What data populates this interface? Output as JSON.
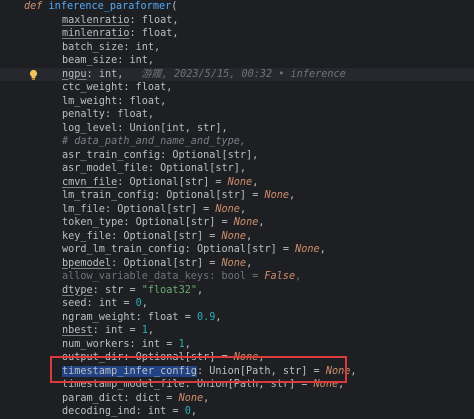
{
  "editor": {
    "lines": [
      {
        "kind": "def",
        "tokens": [
          [
            "kw",
            "def"
          ],
          [
            "sp",
            " "
          ],
          [
            "fn",
            "inference_paraformer"
          ],
          [
            "p",
            "("
          ]
        ]
      },
      {
        "tokens": [
          [
            "pu",
            "maxlenratio"
          ],
          [
            "p",
            ": "
          ],
          [
            "type",
            "float"
          ],
          [
            "p",
            ","
          ]
        ]
      },
      {
        "tokens": [
          [
            "pu",
            "minlenratio"
          ],
          [
            "p",
            ": "
          ],
          [
            "type",
            "float"
          ],
          [
            "p",
            ","
          ]
        ]
      },
      {
        "tokens": [
          [
            "param",
            "batch_size"
          ],
          [
            "p",
            ": "
          ],
          [
            "type",
            "int"
          ],
          [
            "p",
            ","
          ]
        ]
      },
      {
        "tokens": [
          [
            "param",
            "beam_size"
          ],
          [
            "p",
            ": "
          ],
          [
            "type",
            "int"
          ],
          [
            "p",
            ","
          ]
        ]
      },
      {
        "kind": "caret",
        "bulb": true,
        "tokens": [
          [
            "pu",
            "ngpu"
          ],
          [
            "p",
            ": "
          ],
          [
            "type",
            "int"
          ],
          [
            "p",
            ","
          ]
        ],
        "blame": "游履, 2023/5/15, 00:32 • inference"
      },
      {
        "tokens": [
          [
            "param",
            "ctc_weight"
          ],
          [
            "p",
            ": "
          ],
          [
            "type",
            "float"
          ],
          [
            "p",
            ","
          ]
        ]
      },
      {
        "tokens": [
          [
            "param",
            "lm_weight"
          ],
          [
            "p",
            ": "
          ],
          [
            "type",
            "float"
          ],
          [
            "p",
            ","
          ]
        ]
      },
      {
        "tokens": [
          [
            "param",
            "penalty"
          ],
          [
            "p",
            ": "
          ],
          [
            "type",
            "float"
          ],
          [
            "p",
            ","
          ]
        ]
      },
      {
        "tokens": [
          [
            "param",
            "log_level"
          ],
          [
            "p",
            ": "
          ],
          [
            "type",
            "Union"
          ],
          [
            "p",
            "["
          ],
          [
            "type",
            "int"
          ],
          [
            "p",
            ", "
          ],
          [
            "type",
            "str"
          ],
          [
            "p",
            "],"
          ]
        ]
      },
      {
        "tokens": [
          [
            "comment",
            "# data_path_and_name_and_type,"
          ]
        ]
      },
      {
        "tokens": [
          [
            "param",
            "asr_train_config"
          ],
          [
            "p",
            ": "
          ],
          [
            "type",
            "Optional"
          ],
          [
            "p",
            "["
          ],
          [
            "type",
            "str"
          ],
          [
            "p",
            "],"
          ]
        ]
      },
      {
        "tokens": [
          [
            "param",
            "asr_model_file"
          ],
          [
            "p",
            ": "
          ],
          [
            "type",
            "Optional"
          ],
          [
            "p",
            "["
          ],
          [
            "type",
            "str"
          ],
          [
            "p",
            "],"
          ]
        ]
      },
      {
        "tokens": [
          [
            "pu",
            "cmvn_file"
          ],
          [
            "p",
            ": "
          ],
          [
            "type",
            "Optional"
          ],
          [
            "p",
            "["
          ],
          [
            "type",
            "str"
          ],
          [
            "p",
            "] = "
          ],
          [
            "none",
            "None"
          ],
          [
            "p",
            ","
          ]
        ]
      },
      {
        "tokens": [
          [
            "param",
            "lm_train_config"
          ],
          [
            "p",
            ": "
          ],
          [
            "type",
            "Optional"
          ],
          [
            "p",
            "["
          ],
          [
            "type",
            "str"
          ],
          [
            "p",
            "] = "
          ],
          [
            "none",
            "None"
          ],
          [
            "p",
            ","
          ]
        ]
      },
      {
        "tokens": [
          [
            "param",
            "lm_file"
          ],
          [
            "p",
            ": "
          ],
          [
            "type",
            "Optional"
          ],
          [
            "p",
            "["
          ],
          [
            "type",
            "str"
          ],
          [
            "p",
            "] = "
          ],
          [
            "none",
            "None"
          ],
          [
            "p",
            ","
          ]
        ]
      },
      {
        "tokens": [
          [
            "param",
            "token_type"
          ],
          [
            "p",
            ": "
          ],
          [
            "type",
            "Optional"
          ],
          [
            "p",
            "["
          ],
          [
            "type",
            "str"
          ],
          [
            "p",
            "] = "
          ],
          [
            "none",
            "None"
          ],
          [
            "p",
            ","
          ]
        ]
      },
      {
        "tokens": [
          [
            "param",
            "key_file"
          ],
          [
            "p",
            ": "
          ],
          [
            "type",
            "Optional"
          ],
          [
            "p",
            "["
          ],
          [
            "type",
            "str"
          ],
          [
            "p",
            "] = "
          ],
          [
            "none",
            "None"
          ],
          [
            "p",
            ","
          ]
        ]
      },
      {
        "tokens": [
          [
            "param",
            "word_lm_train_config"
          ],
          [
            "p",
            ": "
          ],
          [
            "type",
            "Optional"
          ],
          [
            "p",
            "["
          ],
          [
            "type",
            "str"
          ],
          [
            "p",
            "] = "
          ],
          [
            "none",
            "None"
          ],
          [
            "p",
            ","
          ]
        ]
      },
      {
        "tokens": [
          [
            "pu",
            "bpemodel"
          ],
          [
            "p",
            ": "
          ],
          [
            "type",
            "Optional"
          ],
          [
            "p",
            "["
          ],
          [
            "type",
            "str"
          ],
          [
            "p",
            "] = "
          ],
          [
            "none",
            "None"
          ],
          [
            "p",
            ","
          ]
        ]
      },
      {
        "tokens": [
          [
            "dim",
            "allow_variable_data_keys: bool = "
          ],
          [
            "none",
            "False"
          ],
          [
            "dim",
            ","
          ]
        ]
      },
      {
        "tokens": [
          [
            "pu",
            "dtype"
          ],
          [
            "p",
            ": "
          ],
          [
            "type",
            "str"
          ],
          [
            "p",
            " = "
          ],
          [
            "str",
            "\"float32\""
          ],
          [
            "p",
            ","
          ]
        ]
      },
      {
        "tokens": [
          [
            "param",
            "seed"
          ],
          [
            "p",
            ": "
          ],
          [
            "type",
            "int"
          ],
          [
            "p",
            " = "
          ],
          [
            "num",
            "0"
          ],
          [
            "p",
            ","
          ]
        ]
      },
      {
        "tokens": [
          [
            "param",
            "ngram_weight"
          ],
          [
            "p",
            ": "
          ],
          [
            "type",
            "float"
          ],
          [
            "p",
            " = "
          ],
          [
            "num",
            "0.9"
          ],
          [
            "p",
            ","
          ]
        ]
      },
      {
        "tokens": [
          [
            "pu",
            "nbest"
          ],
          [
            "p",
            ": "
          ],
          [
            "type",
            "int"
          ],
          [
            "p",
            " = "
          ],
          [
            "num",
            "1"
          ],
          [
            "p",
            ","
          ]
        ]
      },
      {
        "tokens": [
          [
            "param",
            "num_workers"
          ],
          [
            "p",
            ": "
          ],
          [
            "type",
            "int"
          ],
          [
            "p",
            " = "
          ],
          [
            "num",
            "1"
          ],
          [
            "p",
            ","
          ]
        ]
      },
      {
        "tokens": [
          [
            "param",
            "output_dir"
          ],
          [
            "p",
            ": "
          ],
          [
            "type",
            "Optional"
          ],
          [
            "p",
            "["
          ],
          [
            "type",
            "str"
          ],
          [
            "p",
            "] = "
          ],
          [
            "none",
            "None"
          ],
          [
            "p",
            ","
          ]
        ]
      },
      {
        "tokens": [
          [
            "sel",
            "timestamp_infer_config"
          ],
          [
            "p",
            ": "
          ],
          [
            "type",
            "Union"
          ],
          [
            "p",
            "["
          ],
          [
            "type",
            "Path"
          ],
          [
            "p",
            ", "
          ],
          [
            "type",
            "str"
          ],
          [
            "p",
            "] = "
          ],
          [
            "none",
            "None"
          ],
          [
            "p",
            ","
          ]
        ]
      },
      {
        "tokens": [
          [
            "param",
            "timestamp_model_file"
          ],
          [
            "p",
            ": "
          ],
          [
            "type",
            "Union"
          ],
          [
            "p",
            "["
          ],
          [
            "type",
            "Path"
          ],
          [
            "p",
            ", "
          ],
          [
            "type",
            "str"
          ],
          [
            "p",
            "] = "
          ],
          [
            "none",
            "None"
          ],
          [
            "p",
            ","
          ]
        ]
      },
      {
        "tokens": [
          [
            "param",
            "param_dict"
          ],
          [
            "p",
            ": "
          ],
          [
            "type",
            "dict"
          ],
          [
            "p",
            " = "
          ],
          [
            "none",
            "None"
          ],
          [
            "p",
            ","
          ]
        ]
      },
      {
        "tokens": [
          [
            "param",
            "decoding_ind"
          ],
          [
            "p",
            ": "
          ],
          [
            "type",
            "int"
          ],
          [
            "p",
            " = "
          ],
          [
            "num",
            "0"
          ],
          [
            "p",
            ","
          ]
        ]
      }
    ]
  },
  "colors": {
    "background": "#1e1f22",
    "highlight_box": "#d93a3a",
    "selection": "#214283",
    "keyword": "#cf8e6d",
    "function": "#56a8f5",
    "string": "#6aab73",
    "number": "#2aacb8",
    "comment": "#7a7e85"
  },
  "icons": {
    "intention_bulb": "lightbulb-icon"
  }
}
